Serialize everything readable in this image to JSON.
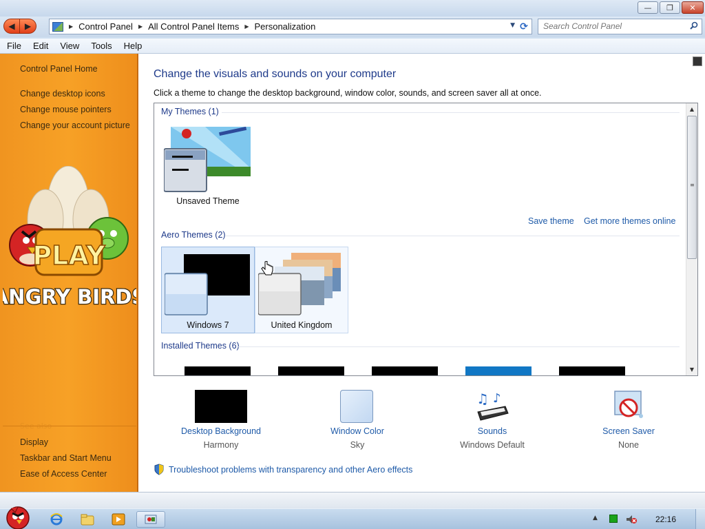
{
  "window": {
    "controls": {
      "minimize": "—",
      "maximize": "❐",
      "close": "✕"
    }
  },
  "address": {
    "crumbs": [
      "Control Panel",
      "All Control Panel Items",
      "Personalization"
    ],
    "search_placeholder": "Search Control Panel"
  },
  "menu": [
    "File",
    "Edit",
    "View",
    "Tools",
    "Help"
  ],
  "sidebar": {
    "home": "Control Panel Home",
    "links": [
      "Change desktop icons",
      "Change mouse pointers",
      "Change your account picture"
    ],
    "see_also": "See also",
    "see_also_links": [
      "Display",
      "Taskbar and Start Menu",
      "Ease of Access Center"
    ],
    "logo_text": {
      "play": "PLAY",
      "title": "ANGRY BIRDS"
    }
  },
  "main": {
    "heading": "Change the visuals and sounds on your computer",
    "subheading": "Click a theme to change the desktop background, window color, sounds, and screen saver all at once.",
    "groups": {
      "my_themes": "My Themes (1)",
      "aero_themes": "Aero Themes (2)",
      "installed_themes": "Installed Themes (6)"
    },
    "my_themes_items": [
      {
        "name": "Unsaved Theme"
      }
    ],
    "aero_items": [
      {
        "name": "Windows 7"
      },
      {
        "name": "United Kingdom"
      }
    ],
    "links": {
      "save": "Save theme",
      "more": "Get more themes online"
    },
    "settings": [
      {
        "label": "Desktop Background",
        "value": "Harmony"
      },
      {
        "label": "Window Color",
        "value": "Sky"
      },
      {
        "label": "Sounds",
        "value": "Windows Default"
      },
      {
        "label": "Screen Saver",
        "value": "None"
      }
    ],
    "troubleshoot": "Troubleshoot problems with transparency and other Aero effects"
  },
  "taskbar": {
    "clock": "22:16",
    "icons": [
      "internet-explorer-icon",
      "windows-explorer-icon",
      "media-player-icon",
      "control-panel-icon"
    ]
  },
  "colors": {
    "sidebar_orange": "#f7a126",
    "link_blue": "#1e5aa8",
    "heading_blue": "#1e3a8a",
    "selected_tile": "#dbe9fa",
    "installed_accent": "#1177c4"
  }
}
